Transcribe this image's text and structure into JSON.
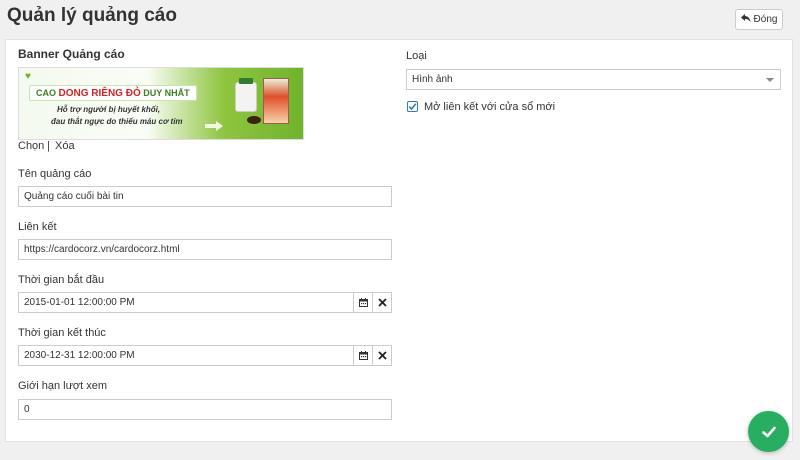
{
  "header": {
    "title": "Quản lý quảng cáo",
    "close_label": "Đóng"
  },
  "banner": {
    "section_title": "Banner Quảng cáo",
    "image_line_bar_prefix": "CAO ",
    "image_line_bar_red": "DONG RIÊNG ĐỎ",
    "image_line_bar_suffix": " DUY NHẤT",
    "image_line2": "Hỗ trợ người bị huyết khối,",
    "image_line3": "đau thắt ngực do thiếu máu cơ tim",
    "choose_label": "Chọn",
    "separator": "|",
    "delete_label": "Xóa"
  },
  "form": {
    "name_label": "Tên quảng cáo",
    "name_value": "Quảng cáo cuối bài tin",
    "link_label": "Liên kết",
    "link_value": "https://cardocorz.vn/cardocorz.html",
    "start_label": "Thời gian bắt đầu",
    "start_value": "2015-01-01 12:00:00 PM",
    "end_label": "Thời gian kết thúc",
    "end_value": "2030-12-31 12:00:00 PM",
    "views_label": "Giới hạn lượt xem",
    "views_value": "0"
  },
  "right": {
    "type_label": "Loại",
    "type_value": "Hình ảnh",
    "new_window_label": "Mở liên kết với cửa sổ mới",
    "new_window_checked": true
  },
  "icons": {
    "close": "reply-icon",
    "calendar": "calendar-icon",
    "clear": "close-icon",
    "save": "check-icon"
  },
  "colors": {
    "accent": "#27ae60",
    "checkbox": "#337ab7"
  }
}
